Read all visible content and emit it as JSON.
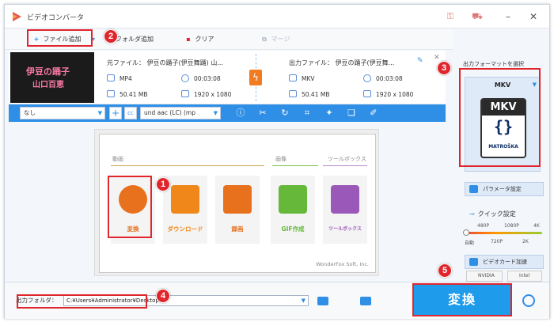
{
  "app": {
    "title": "ビデオコンバータ"
  },
  "toolbar": {
    "add_file": "ファイル追加",
    "add_folder": "フォルダ追加",
    "clear": "クリア",
    "merge": "マージ"
  },
  "file": {
    "thumb_line1": "伊豆の踊子",
    "thumb_line2": "山口百恵",
    "source_label": "元ファイル： 伊豆の踊子(伊豆舞踊) 山...",
    "source_format": "MP4",
    "source_duration": "00:03:08",
    "source_size": "50.41 MB",
    "source_resolution": "1920 x 1080",
    "output_label": "出力ファイル： 伊豆の踊子(伊豆舞...",
    "output_format": "MKV",
    "output_duration": "00:03:08",
    "output_size": "50.41 MB",
    "output_resolution": "1920 x 1080"
  },
  "options": {
    "subtitle": "なし",
    "audio": "und aac (LC) (mp"
  },
  "center": {
    "section_video": "動画",
    "section_image": "画像",
    "section_toolbox": "ツールボックス",
    "tiles": [
      {
        "label": "変換",
        "color": "#e8711e"
      },
      {
        "label": "ダウンロード",
        "color": "#f0871a"
      },
      {
        "label": "録画",
        "color": "#e8711e"
      },
      {
        "label": "GIF作成",
        "color": "#66b83a"
      },
      {
        "label": "ツールボックス",
        "color": "#9a58b8"
      }
    ],
    "brand": "WonderFox Soft, Inc."
  },
  "right_panel": {
    "title": "出力フォーマットを選択",
    "format": "MKV",
    "mkv_top": "MKV",
    "mkv_sub": "MATROŠKA",
    "params": "パラメータ設定",
    "quick_title": "クイック設定",
    "quality_top": [
      "480P",
      "1080P",
      "4K"
    ],
    "quality_bottom": [
      "自動",
      "720P",
      "2K"
    ],
    "gpu_accel": "ビデオカード加速",
    "nvidia": "NVIDIA",
    "intel": "Intel"
  },
  "bottom": {
    "output_folder_label": "出力フォルダ：",
    "output_folder_path": "C:¥Users¥Administrator¥Desktop",
    "convert": "変換"
  },
  "markers": [
    "1",
    "2",
    "3",
    "4",
    "5"
  ],
  "colors": {
    "accent": "#2f8fe6",
    "highlight": "#e0262c",
    "convert": "#1e9bea"
  }
}
